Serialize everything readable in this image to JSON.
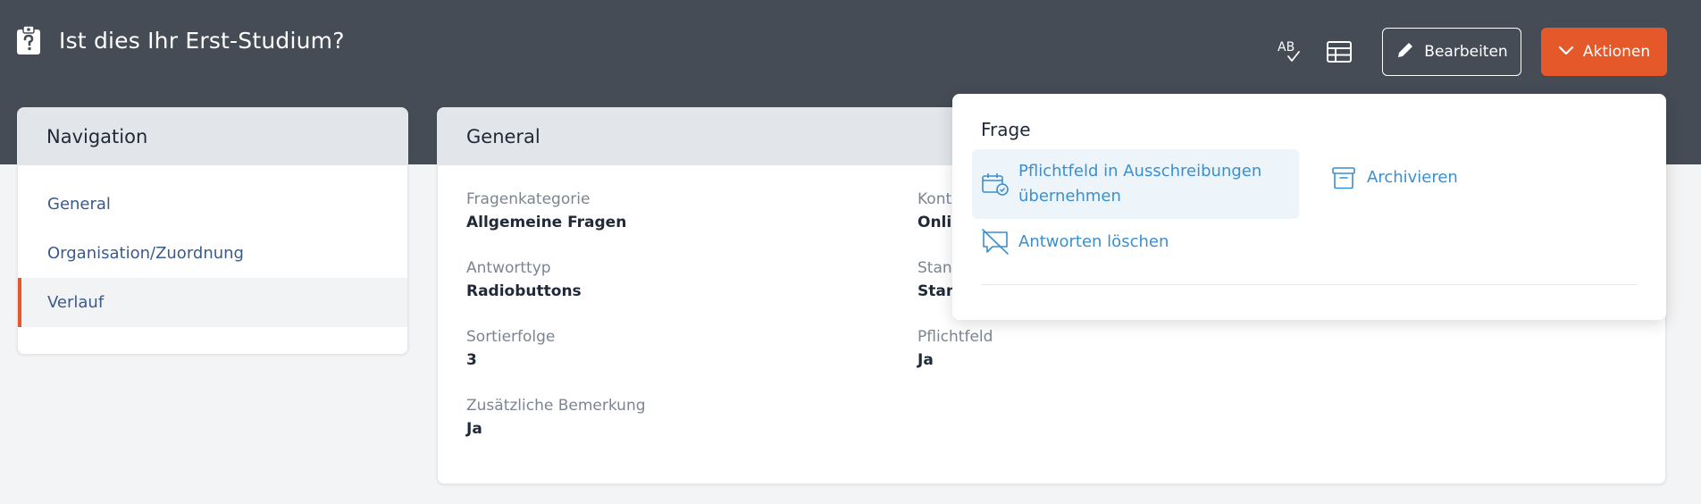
{
  "header": {
    "title": "Ist dies Ihr Erst-Studium?",
    "title_icon": "clipboard-question-icon",
    "spellcheck_icon_text": "AB",
    "edit_label": "Bearbeiten",
    "actions_label": "Aktionen"
  },
  "navigation": {
    "title": "Navigation",
    "items": [
      {
        "label": "General"
      },
      {
        "label": "Organisation/Zuordnung"
      },
      {
        "label": "Verlauf"
      }
    ]
  },
  "general": {
    "title": "General",
    "fields": [
      {
        "label": "Fragenkategorie",
        "value": "Allgemeine Fragen"
      },
      {
        "label": "Antworttyp",
        "value": "Radiobuttons"
      },
      {
        "label": "Sortierfolge",
        "value": "3"
      },
      {
        "label": "Zusätzliche Bemerkung",
        "value": "Ja"
      },
      {
        "label": "Kont",
        "value": "Onlin"
      },
      {
        "label": "Stan",
        "value": "Stan"
      },
      {
        "label": "Pflichtfeld",
        "value": "Ja"
      }
    ]
  },
  "actions_menu": {
    "section_title": "Frage",
    "items": [
      {
        "label_line1": "Pflichtfeld in Ausschreibungen",
        "label_line2": "übernehmen",
        "icon": "calendar-check-icon"
      },
      {
        "label": "Archivieren",
        "icon": "archive-icon"
      },
      {
        "label": "Antworten löschen",
        "icon": "comment-slash-icon"
      }
    ]
  },
  "colors": {
    "topbar": "#454c56",
    "accent": "#e5582a",
    "link": "#3b5a8c",
    "menu_link": "#3a8fcf"
  }
}
